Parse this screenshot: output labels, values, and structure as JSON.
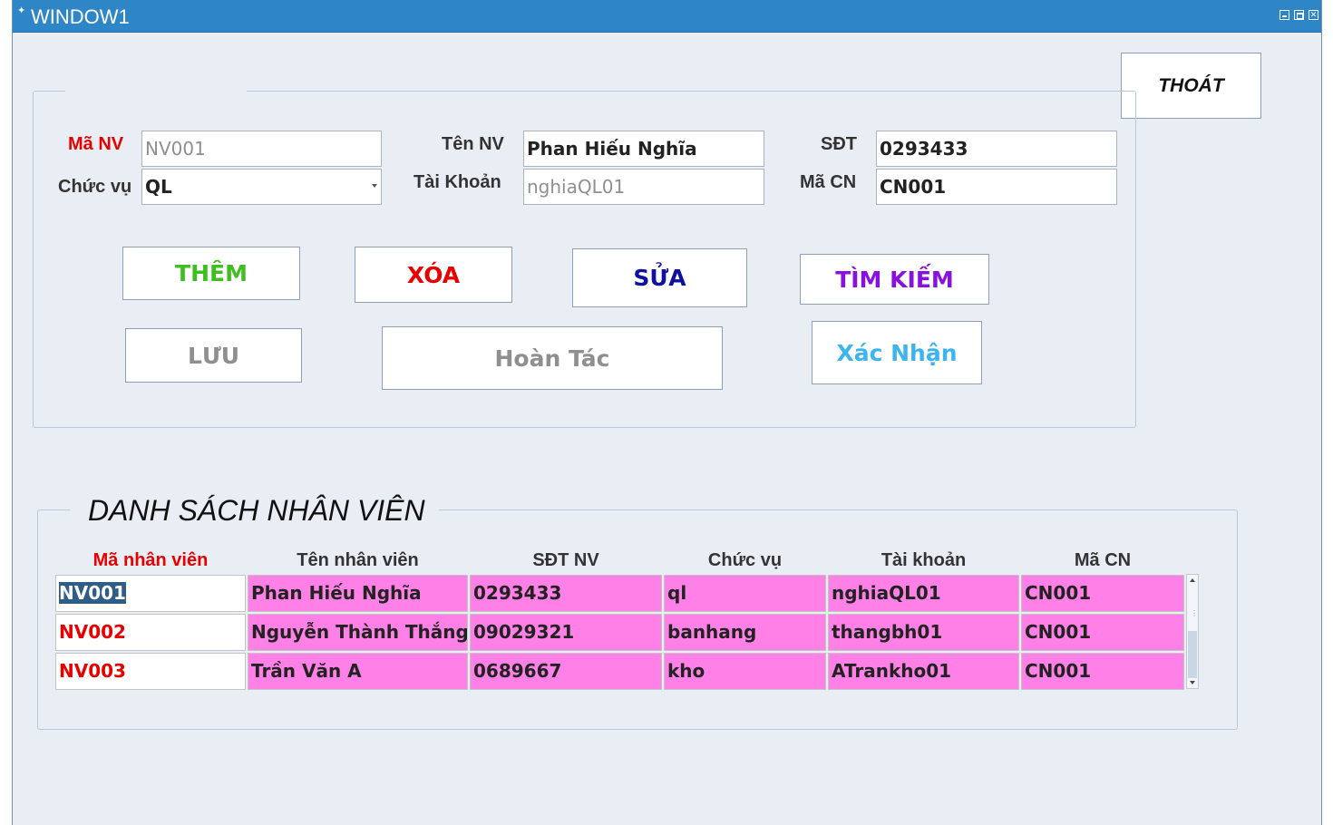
{
  "window": {
    "title": "WINDOW1"
  },
  "toolbar": {
    "exit_label": "THOÁT"
  },
  "form": {
    "ma_nv": {
      "label": "Mã NV",
      "value": "NV001"
    },
    "ten_nv": {
      "label": "Tên NV",
      "value": "Phan Hiếu Nghĩa"
    },
    "sdt": {
      "label": "SĐT",
      "value": "0293433"
    },
    "chuc_vu": {
      "label": "Chức vụ",
      "value": "QL"
    },
    "tai_khoan": {
      "label": "Tài Khoản",
      "value": "nghiaQL01"
    },
    "ma_cn": {
      "label": "Mã CN",
      "value": "CN001"
    }
  },
  "buttons": {
    "add": "THÊM",
    "delete": "XÓA",
    "edit": "SỬA",
    "search": "TÌM KIẾM",
    "save": "LƯU",
    "undo": "Hoàn Tác",
    "confirm": "Xác Nhận"
  },
  "colors": {
    "add": "#3fbf1f",
    "delete": "#e60000",
    "edit": "#1010a0",
    "search": "#8a10e0",
    "save": "#8f8f8f",
    "undo": "#8f8f8f",
    "confirm": "#3cb4ee",
    "row_highlight": "#ff80e6",
    "titlebar": "#2f86c6"
  },
  "list": {
    "title": "DANH SÁCH NHÂN VIÊN",
    "columns": [
      "Mã nhân viên",
      "Tên nhân viên",
      "SĐT NV",
      "Chức vụ",
      "Tài khoản",
      "Mã CN"
    ],
    "rows": [
      [
        "NV001",
        "Phan Hiếu Nghĩa",
        "0293433",
        "ql",
        "nghiaQL01",
        "CN001"
      ],
      [
        "NV002",
        "Nguyễn Thành Thắng",
        "09029321",
        "banhang",
        "thangbh01",
        "CN001"
      ],
      [
        "NV003",
        "Trần Văn A",
        "0689667",
        "kho",
        "ATrankho01",
        "CN001"
      ]
    ],
    "selected_row": 0
  }
}
